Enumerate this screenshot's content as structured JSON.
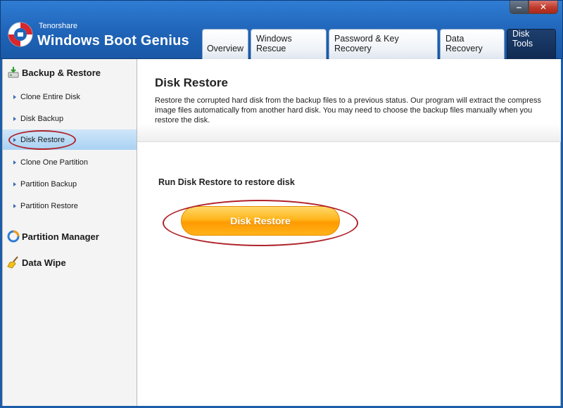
{
  "header": {
    "brand_small": "Tenorshare",
    "brand_big": "Windows Boot Genius",
    "window_buttons": {
      "minimize": "‒",
      "close": "✕"
    }
  },
  "tabs": [
    {
      "label": "Overview"
    },
    {
      "label": "Windows Rescue"
    },
    {
      "label": "Password & Key Recovery"
    },
    {
      "label": "Data Recovery"
    },
    {
      "label": "Disk Tools",
      "active": true
    }
  ],
  "sidebar": {
    "sections": [
      {
        "label": "Backup & Restore",
        "icon": "backup-icon"
      },
      {
        "label": "Partition Manager",
        "icon": "partition-icon"
      },
      {
        "label": "Data Wipe",
        "icon": "broom-icon"
      }
    ],
    "items": [
      {
        "label": "Clone Entire Disk"
      },
      {
        "label": "Disk Backup"
      },
      {
        "label": "Disk Restore",
        "selected": true
      },
      {
        "label": "Clone One Partition"
      },
      {
        "label": "Partition Backup"
      },
      {
        "label": "Partition Restore"
      }
    ]
  },
  "main": {
    "title": "Disk Restore",
    "description": "Restore the corrupted hard disk from the backup files to a previous status. Our program will extract the compress image files automatically from another hard disk. You may need to choose the backup files manually when you restore the disk.",
    "run_label": "Run Disk Restore to restore disk",
    "button_label": "Disk Restore"
  },
  "colors": {
    "header_blue": "#1f64b8",
    "active_tab": "#0f2a52",
    "selected_item": "#a9d2f3",
    "button_orange": "#ff9a00",
    "highlight_red": "#b0232b"
  }
}
